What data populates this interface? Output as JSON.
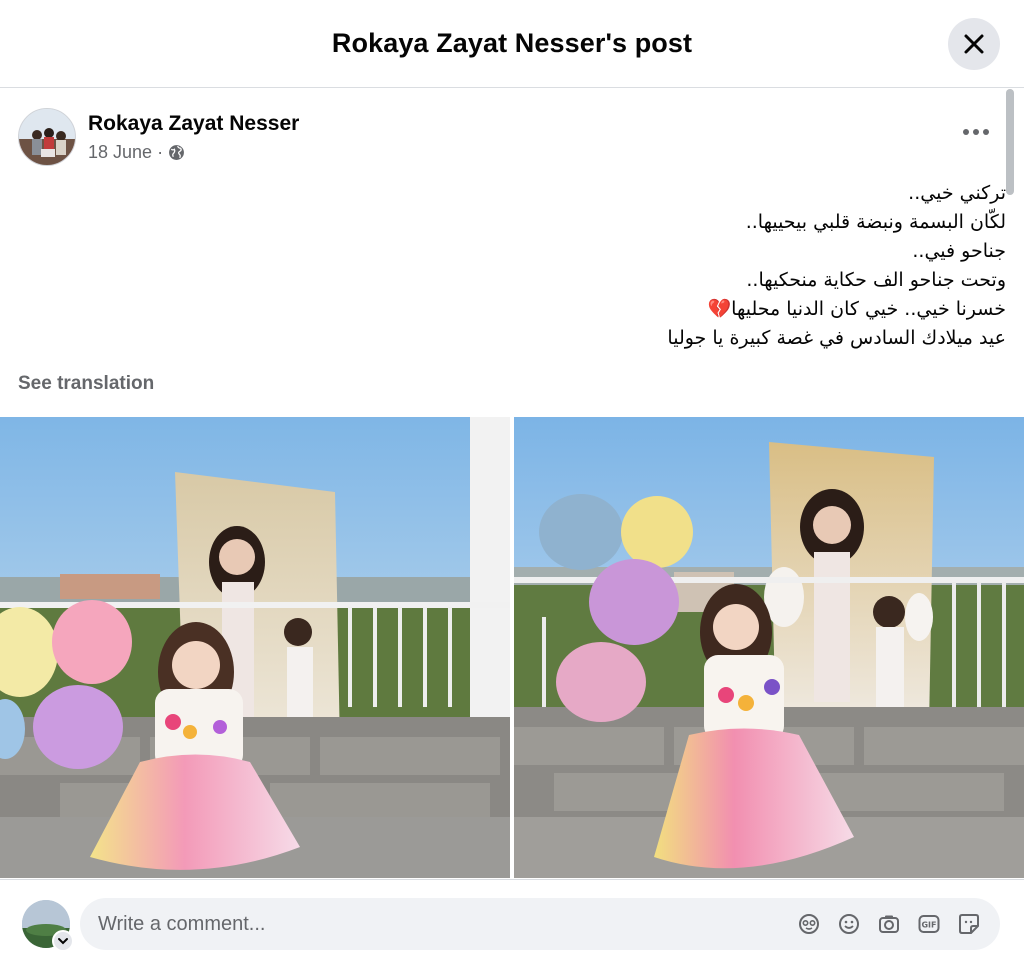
{
  "header": {
    "title": "Rokaya Zayat Nesser's post",
    "close_icon": "close-icon"
  },
  "post": {
    "author": "Rokaya Zayat Nesser",
    "date": "18 June",
    "separator": "·",
    "audience_icon": "globe-icon",
    "more_icon": "more-horizontal-icon",
    "text_lines": [
      "تركني خيي..",
      "لكّان البسمة ونبضة قلبي بيحييها..",
      "جناحو فيي..",
      "وتحت جناحو الف حكاية  منحكيها..",
      "خسرنا خيي.. خيي كان الدنيا  محليها💔",
      "عيد ميلادك السادس في غصة كبيرة يا جوليا"
    ],
    "see_translation": "See translation",
    "photo_count": 2
  },
  "comment": {
    "placeholder": "Write a comment...",
    "icons": [
      "avatar-sticker-icon",
      "emoji-icon",
      "camera-icon",
      "gif-icon",
      "sticker-icon"
    ]
  },
  "colors": {
    "secondary_text": "#65676b",
    "input_bg": "#f0f2f5",
    "close_bg": "#e4e6eb"
  }
}
